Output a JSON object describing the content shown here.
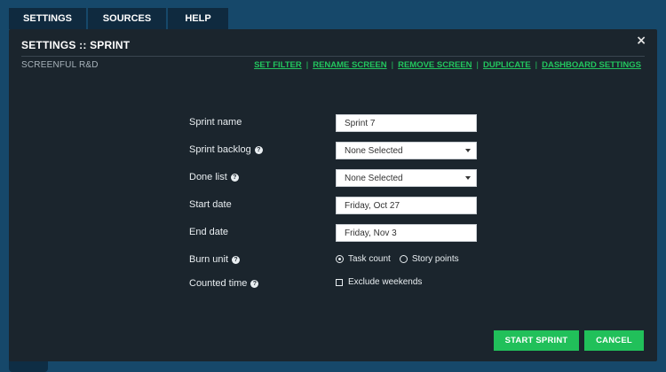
{
  "tabs": [
    {
      "label": "SETTINGS"
    },
    {
      "label": "SOURCES"
    },
    {
      "label": "HELP"
    }
  ],
  "modal": {
    "title": "SETTINGS :: SPRINT",
    "subtitle": "SCREENFUL R&D",
    "close_icon": "×",
    "links": [
      {
        "label": "SET FILTER"
      },
      {
        "label": "RENAME SCREEN"
      },
      {
        "label": "REMOVE SCREEN"
      },
      {
        "label": "DUPLICATE"
      },
      {
        "label": "DASHBOARD SETTINGS"
      }
    ],
    "link_separator": "|"
  },
  "form": {
    "sprint_name": {
      "label": "Sprint name",
      "value": "Sprint 7"
    },
    "sprint_backlog": {
      "label": "Sprint backlog",
      "value": "None Selected"
    },
    "done_list": {
      "label": "Done list",
      "value": "None Selected"
    },
    "start_date": {
      "label": "Start date",
      "value": "Friday, Oct 27"
    },
    "end_date": {
      "label": "End date",
      "value": "Friday, Nov 3"
    },
    "burn_unit": {
      "label": "Burn unit",
      "options": [
        "Task count",
        "Story points"
      ],
      "selected": "Task count"
    },
    "counted_time": {
      "label": "Counted time",
      "checkbox_label": "Exclude weekends",
      "checked": false
    }
  },
  "buttons": {
    "start_sprint": "START SPRINT",
    "cancel": "CANCEL"
  },
  "icons": {
    "help": "?"
  },
  "colors": {
    "accent": "#21c05a",
    "modal_bg": "#1b252d",
    "page_bg": "#16486a"
  }
}
